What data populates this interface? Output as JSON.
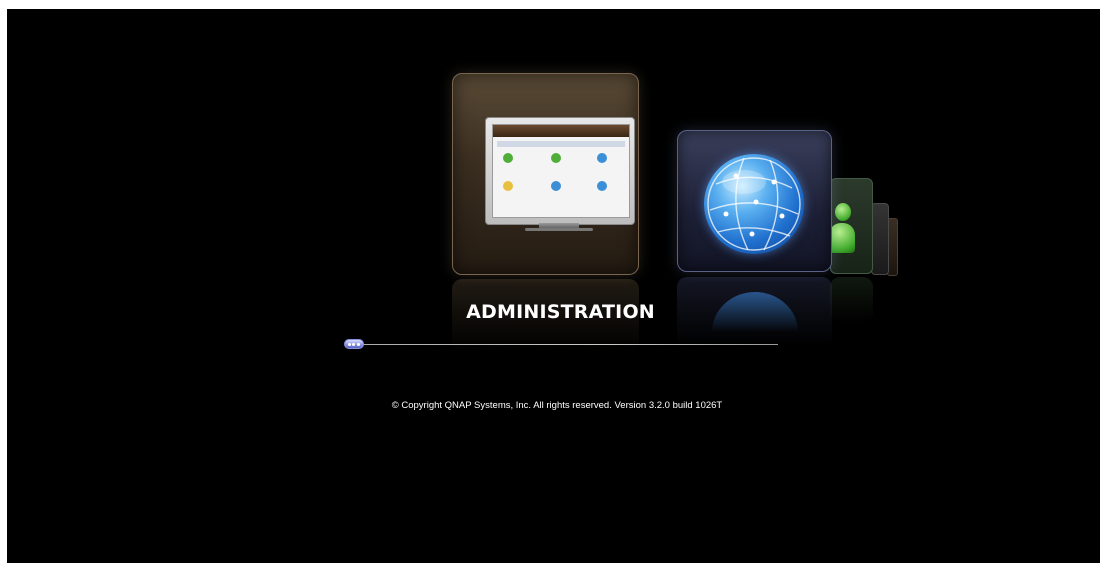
{
  "carousel": {
    "active_label": "ADMINISTRATION",
    "items": [
      {
        "id": "administration",
        "icon": "monitor-icon",
        "accent": "#5a4a36"
      },
      {
        "id": "web",
        "icon": "globe-icon",
        "accent": "#3a3f5c"
      },
      {
        "id": "users",
        "icon": "users-icon",
        "accent": "#3fa92a"
      },
      {
        "id": "mini1",
        "icon": "app-icon",
        "accent": "#343434"
      },
      {
        "id": "mini2",
        "icon": "app-icon",
        "accent": "#3a2e22"
      }
    ]
  },
  "slider": {
    "position_fraction": 0.0
  },
  "footer": {
    "copyright": "© Copyright QNAP Systems, Inc. All rights reserved. Version 3.2.0 build 1026T"
  },
  "colors": {
    "background": "#000000",
    "text": "#ffffff",
    "slider_handle": "#5660c8"
  }
}
